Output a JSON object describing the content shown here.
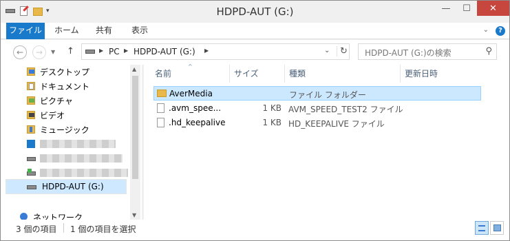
{
  "window": {
    "title": "HDPD-AUT (G:)"
  },
  "ribbon": {
    "tabs": [
      "ファイル",
      "ホーム",
      "共有",
      "表示"
    ]
  },
  "address": {
    "crumbs": [
      "PC",
      "HDPD-AUT (G:)"
    ],
    "search_placeholder": "HDPD-AUT (G:)の検索"
  },
  "nav": {
    "items": [
      "デスクトップ",
      "ドキュメント",
      "ピクチャ",
      "ビデオ",
      "ミュージック"
    ],
    "selected_drive": "HDPD-AUT (G:)",
    "network": "ネットワーク"
  },
  "columns": {
    "name": "名前",
    "size": "サイズ",
    "type": "種類",
    "modified": "更新日時"
  },
  "files": [
    {
      "name": "AverMedia",
      "size": "",
      "type": "ファイル フォルダー"
    },
    {
      "name": ".avm_spee...",
      "size": "1 KB",
      "type": "AVM_SPEED_TEST2 ファイル"
    },
    {
      "name": ".hd_keepalive",
      "size": "1 KB",
      "type": "HD_KEEPALIVE ファイル"
    }
  ],
  "status": {
    "count": "3 個の項目",
    "selected": "1 個の項目を選択"
  },
  "colors": {
    "accent": "#1979ca",
    "close": "#c7463d",
    "selection": "#cce8ff"
  }
}
